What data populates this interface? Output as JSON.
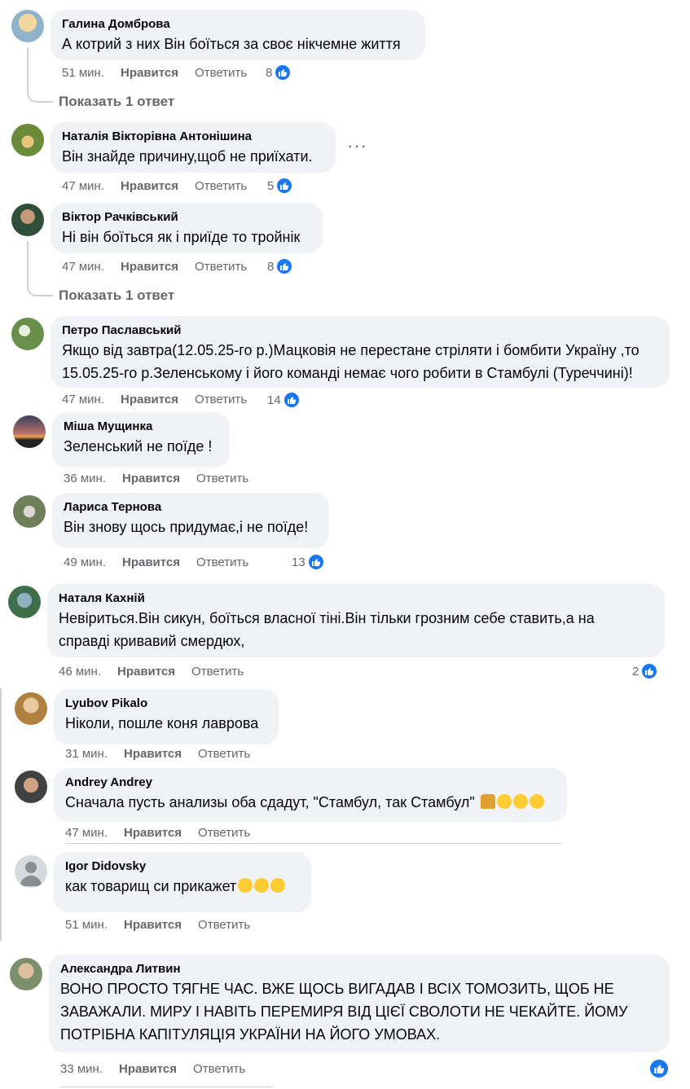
{
  "comments": [
    {
      "author": "Галина Домброва",
      "text": "А котрий з них Він боїться за своє нікчемне життя",
      "time": "51 мин.",
      "like": "Нравится",
      "reply": "Ответить",
      "count": "8"
    },
    {
      "author": "Наталія Вікторівна Антонішина",
      "text": "Він знайде причину,щоб не приїхати.",
      "time": "47 мин.",
      "like": "Нравится",
      "reply": "Ответить",
      "count": "5"
    },
    {
      "author": "Віктор Рачківський",
      "text": "Ні він боїться як і приїде то тройнік",
      "time": "47 мин.",
      "like": "Нравится",
      "reply": "Ответить",
      "count": "8"
    },
    {
      "author": "Петро Паславський",
      "text": "Якщо від завтра(12.05.25-го р.)Мацковія не перестане стріляти і бомбити Україну ,то\n15.05.25-го р.Зеленському і його команді немає чого робити в Стамбулі (Туреччині)!",
      "time": "47 мин.",
      "like": "Нравится",
      "reply": "Ответить",
      "count": "14"
    },
    {
      "author": "Міша Мущинка",
      "text": "Зеленський не поїде !",
      "time": "36 мин.",
      "like": "Нравится",
      "reply": "Ответить"
    },
    {
      "author": "Лариса Тернова",
      "text": "Він знову щось придумає,і не поїде!",
      "time": "49 мин.",
      "like": "Нравится",
      "reply": "Ответить",
      "count": "13"
    },
    {
      "author": "Наталя Кахній",
      "text": "Невіриться.Він сикун, боїться власної тіні.Він тільки грозним себе ставить,а на\nсправді кривавий смердюх,",
      "time": "46 мин.",
      "like": "Нравится",
      "reply": "Ответить",
      "count": "2"
    },
    {
      "author": "Lyubov Pikalo",
      "text": "Ніколи, пошле коня лаврова",
      "time": "31 мин.",
      "like": "Нравится",
      "reply": "Ответить"
    },
    {
      "author": "Andrey Andrey",
      "text": "Сначала пусть анализы оба сдадут, \"Стамбул, так Стамбул\"",
      "time": "47 мин.",
      "like": "Нравится",
      "reply": "Ответить"
    },
    {
      "author": "Igor Didovsky",
      "text": "как товарищ си прикажет",
      "time": "51 мин.",
      "like": "Нравится",
      "reply": "Ответить"
    },
    {
      "author": "Александра Литвин",
      "text": "ВОНО ПРОСТО ТЯГНЕ ЧАС. ВЖЕ ЩОСЬ ВИГАДАВ І ВСІХ ТОМОЗИТЬ, ЩОБ НЕ\nЗАВАЖАЛИ. МИРУ І НАВІТЬ ПЕРЕМИРЯ ВІД ЦІЄЇ СВОЛОТИ НЕ ЧЕКАЙТЕ. ЙОМУ\nПОТРІБНА КАПІТУЛЯЦІЯ УКРАЇНИ НА ЙОГО УМОВАХ.",
      "time": "33 мин.",
      "like": "Нравится",
      "reply": "Ответить"
    }
  ],
  "show_replies_1": "Показать 1 ответ",
  "show_replies_2": "Показать 1 ответ",
  "more_options": "···",
  "colors": {
    "like_blue": "#1877f2",
    "bubble": "#f0f2f5",
    "meta": "#65676b"
  },
  "icons": {
    "like": "thumbs-up-icon",
    "laugh": "rolling-laughing-emoji",
    "joy": "tears-of-joy-emoji",
    "person": "person-emoji"
  }
}
